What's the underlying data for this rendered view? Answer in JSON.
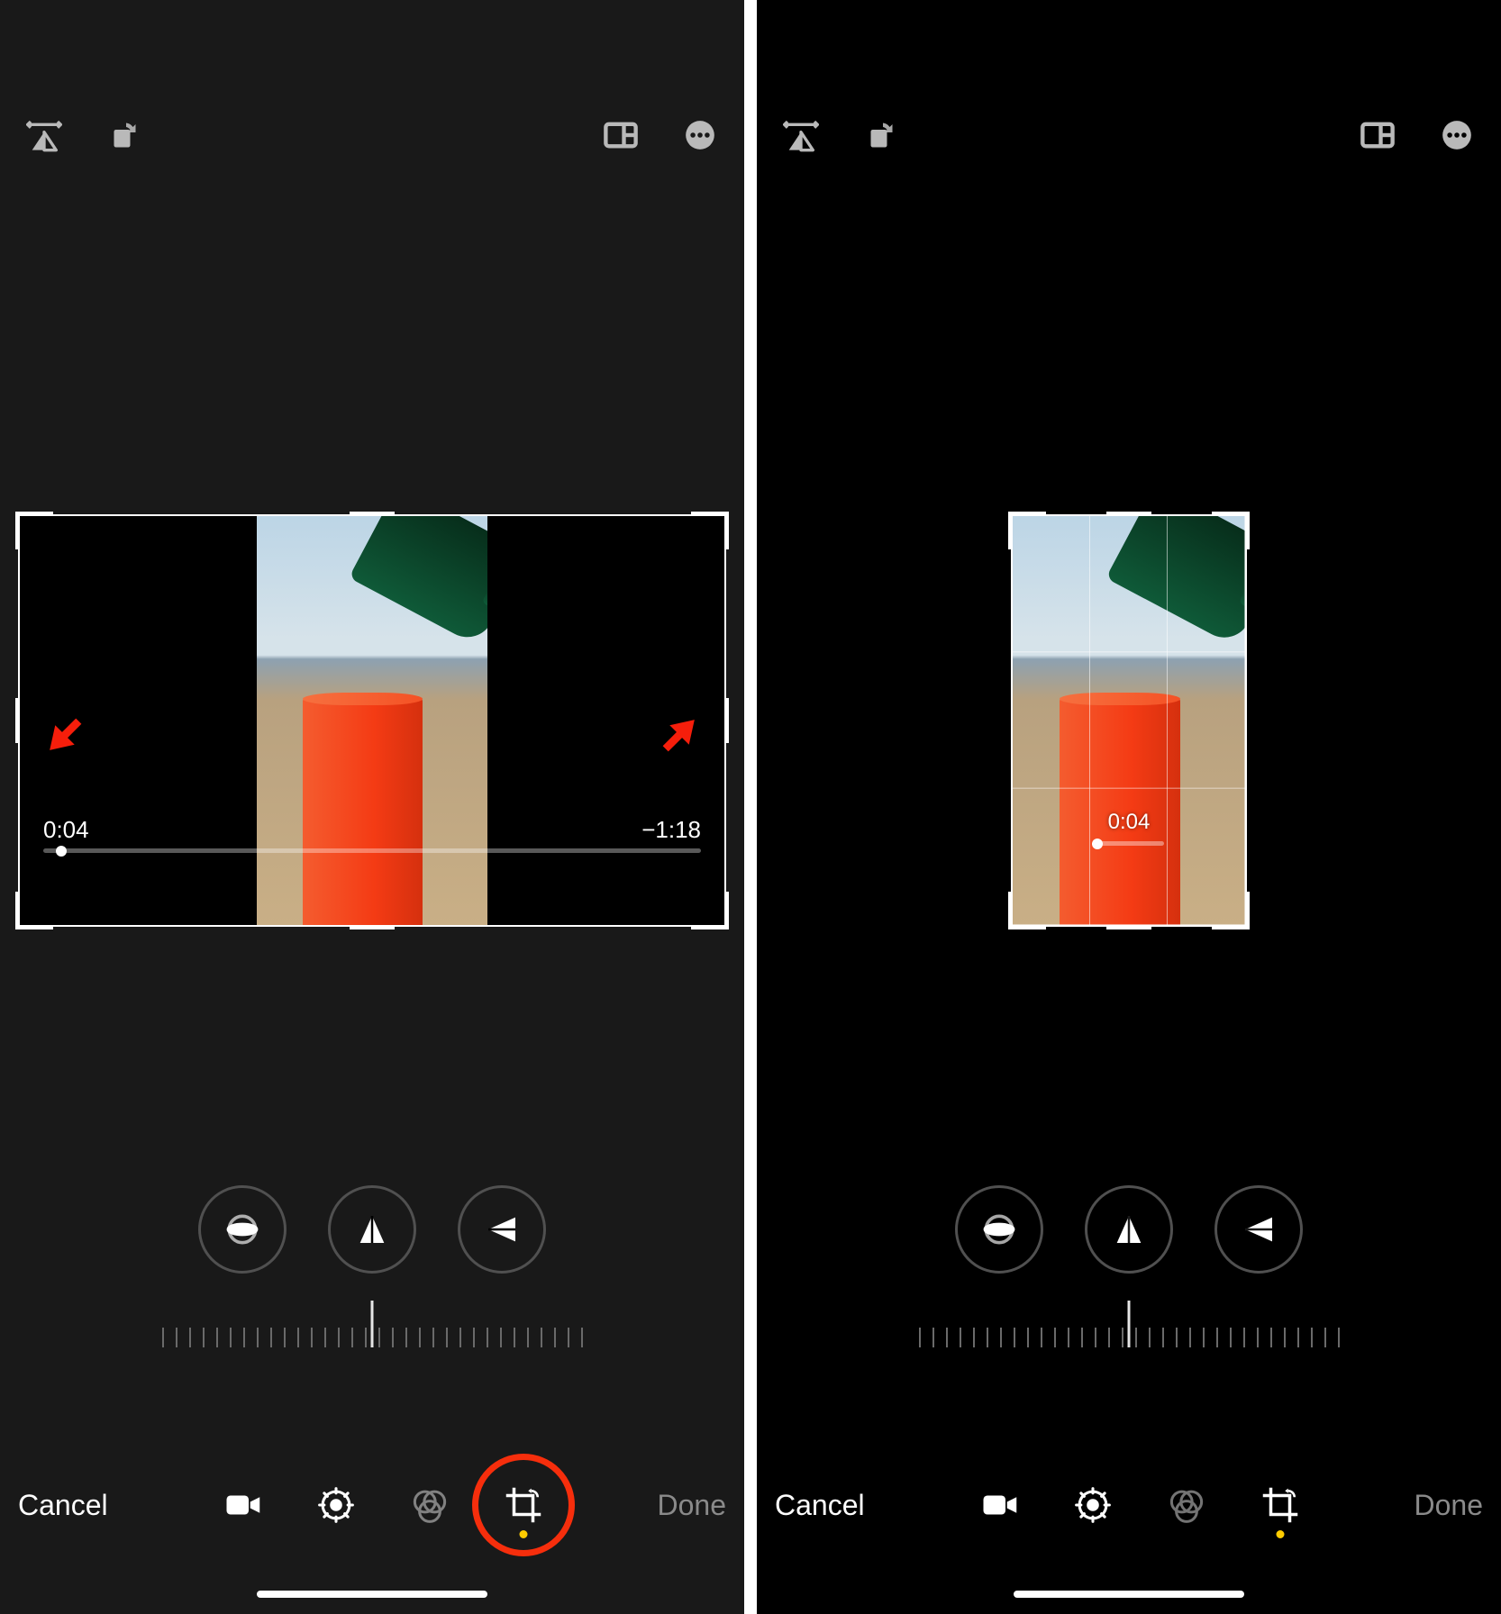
{
  "left": {
    "topbar": {
      "flip_h": "flip-horizontal-icon",
      "rotate": "rotate-icon",
      "aspect": "aspect-ratio-icon",
      "more": "more-icon"
    },
    "preview": {
      "time_current": "0:04",
      "time_remaining": "−1:18"
    },
    "bottom": {
      "cancel": "Cancel",
      "done": "Done"
    }
  },
  "right": {
    "preview": {
      "time_current": "0:04"
    },
    "bottom": {
      "cancel": "Cancel",
      "done": "Done"
    }
  },
  "colors": {
    "annotation_red": "#f62e0c",
    "accent_yellow": "#ffcc00"
  }
}
